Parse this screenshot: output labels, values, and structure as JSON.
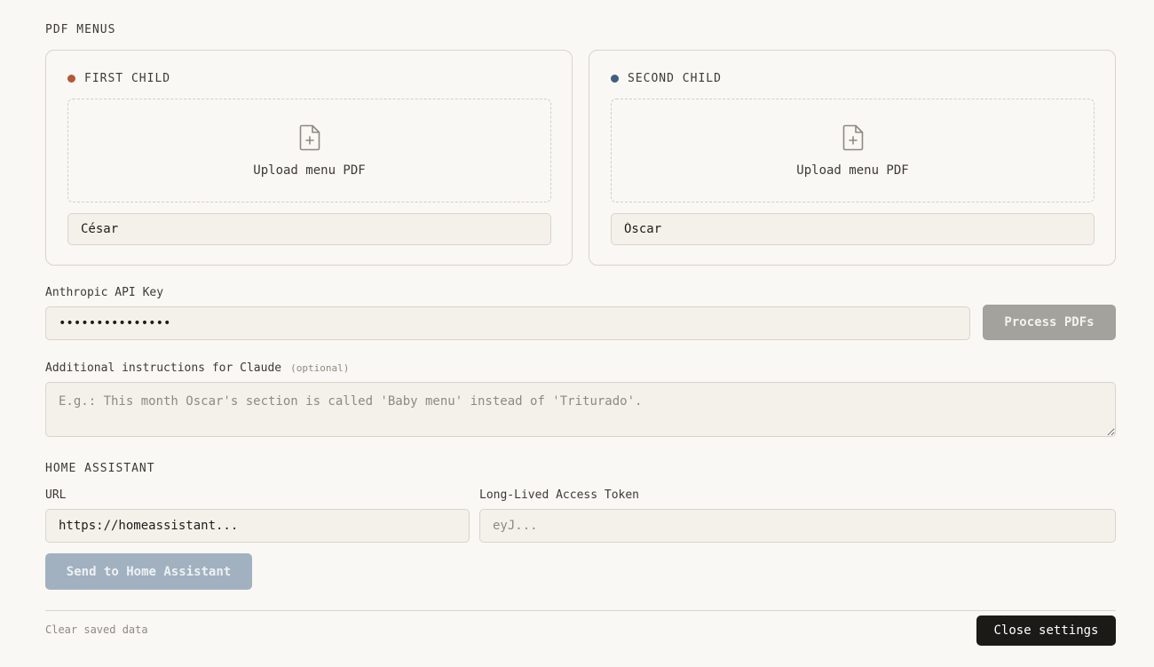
{
  "pdf_menus": {
    "title": "PDF MENUS",
    "children": [
      {
        "label": "FIRST CHILD",
        "dot_color": "#b5583a",
        "upload_label": "Upload menu PDF",
        "name_value": "César"
      },
      {
        "label": "SECOND CHILD",
        "dot_color": "#3e5f82",
        "upload_label": "Upload menu PDF",
        "name_value": "Óscar"
      }
    ]
  },
  "api": {
    "label": "Anthropic API Key",
    "value": "•••••••••••••••",
    "process_label": "Process PDFs"
  },
  "instructions": {
    "label": "Additional instructions for Claude",
    "optional": "(optional)",
    "placeholder": "E.g.: This month Oscar's section is called 'Baby menu' instead of 'Triturado'."
  },
  "home_assistant": {
    "title": "HOME ASSISTANT",
    "url_label": "URL",
    "url_value": "https://homeassistant...",
    "token_label": "Long-Lived Access Token",
    "token_placeholder": "eyJ...",
    "send_label": "Send to Home Assistant"
  },
  "footer": {
    "clear_label": "Clear saved data",
    "close_label": "Close settings"
  },
  "colors": {
    "process_button_bg": "#a3a29d",
    "send_button_bg": "#a1b1c0",
    "close_button_bg": "#1b1a17"
  }
}
